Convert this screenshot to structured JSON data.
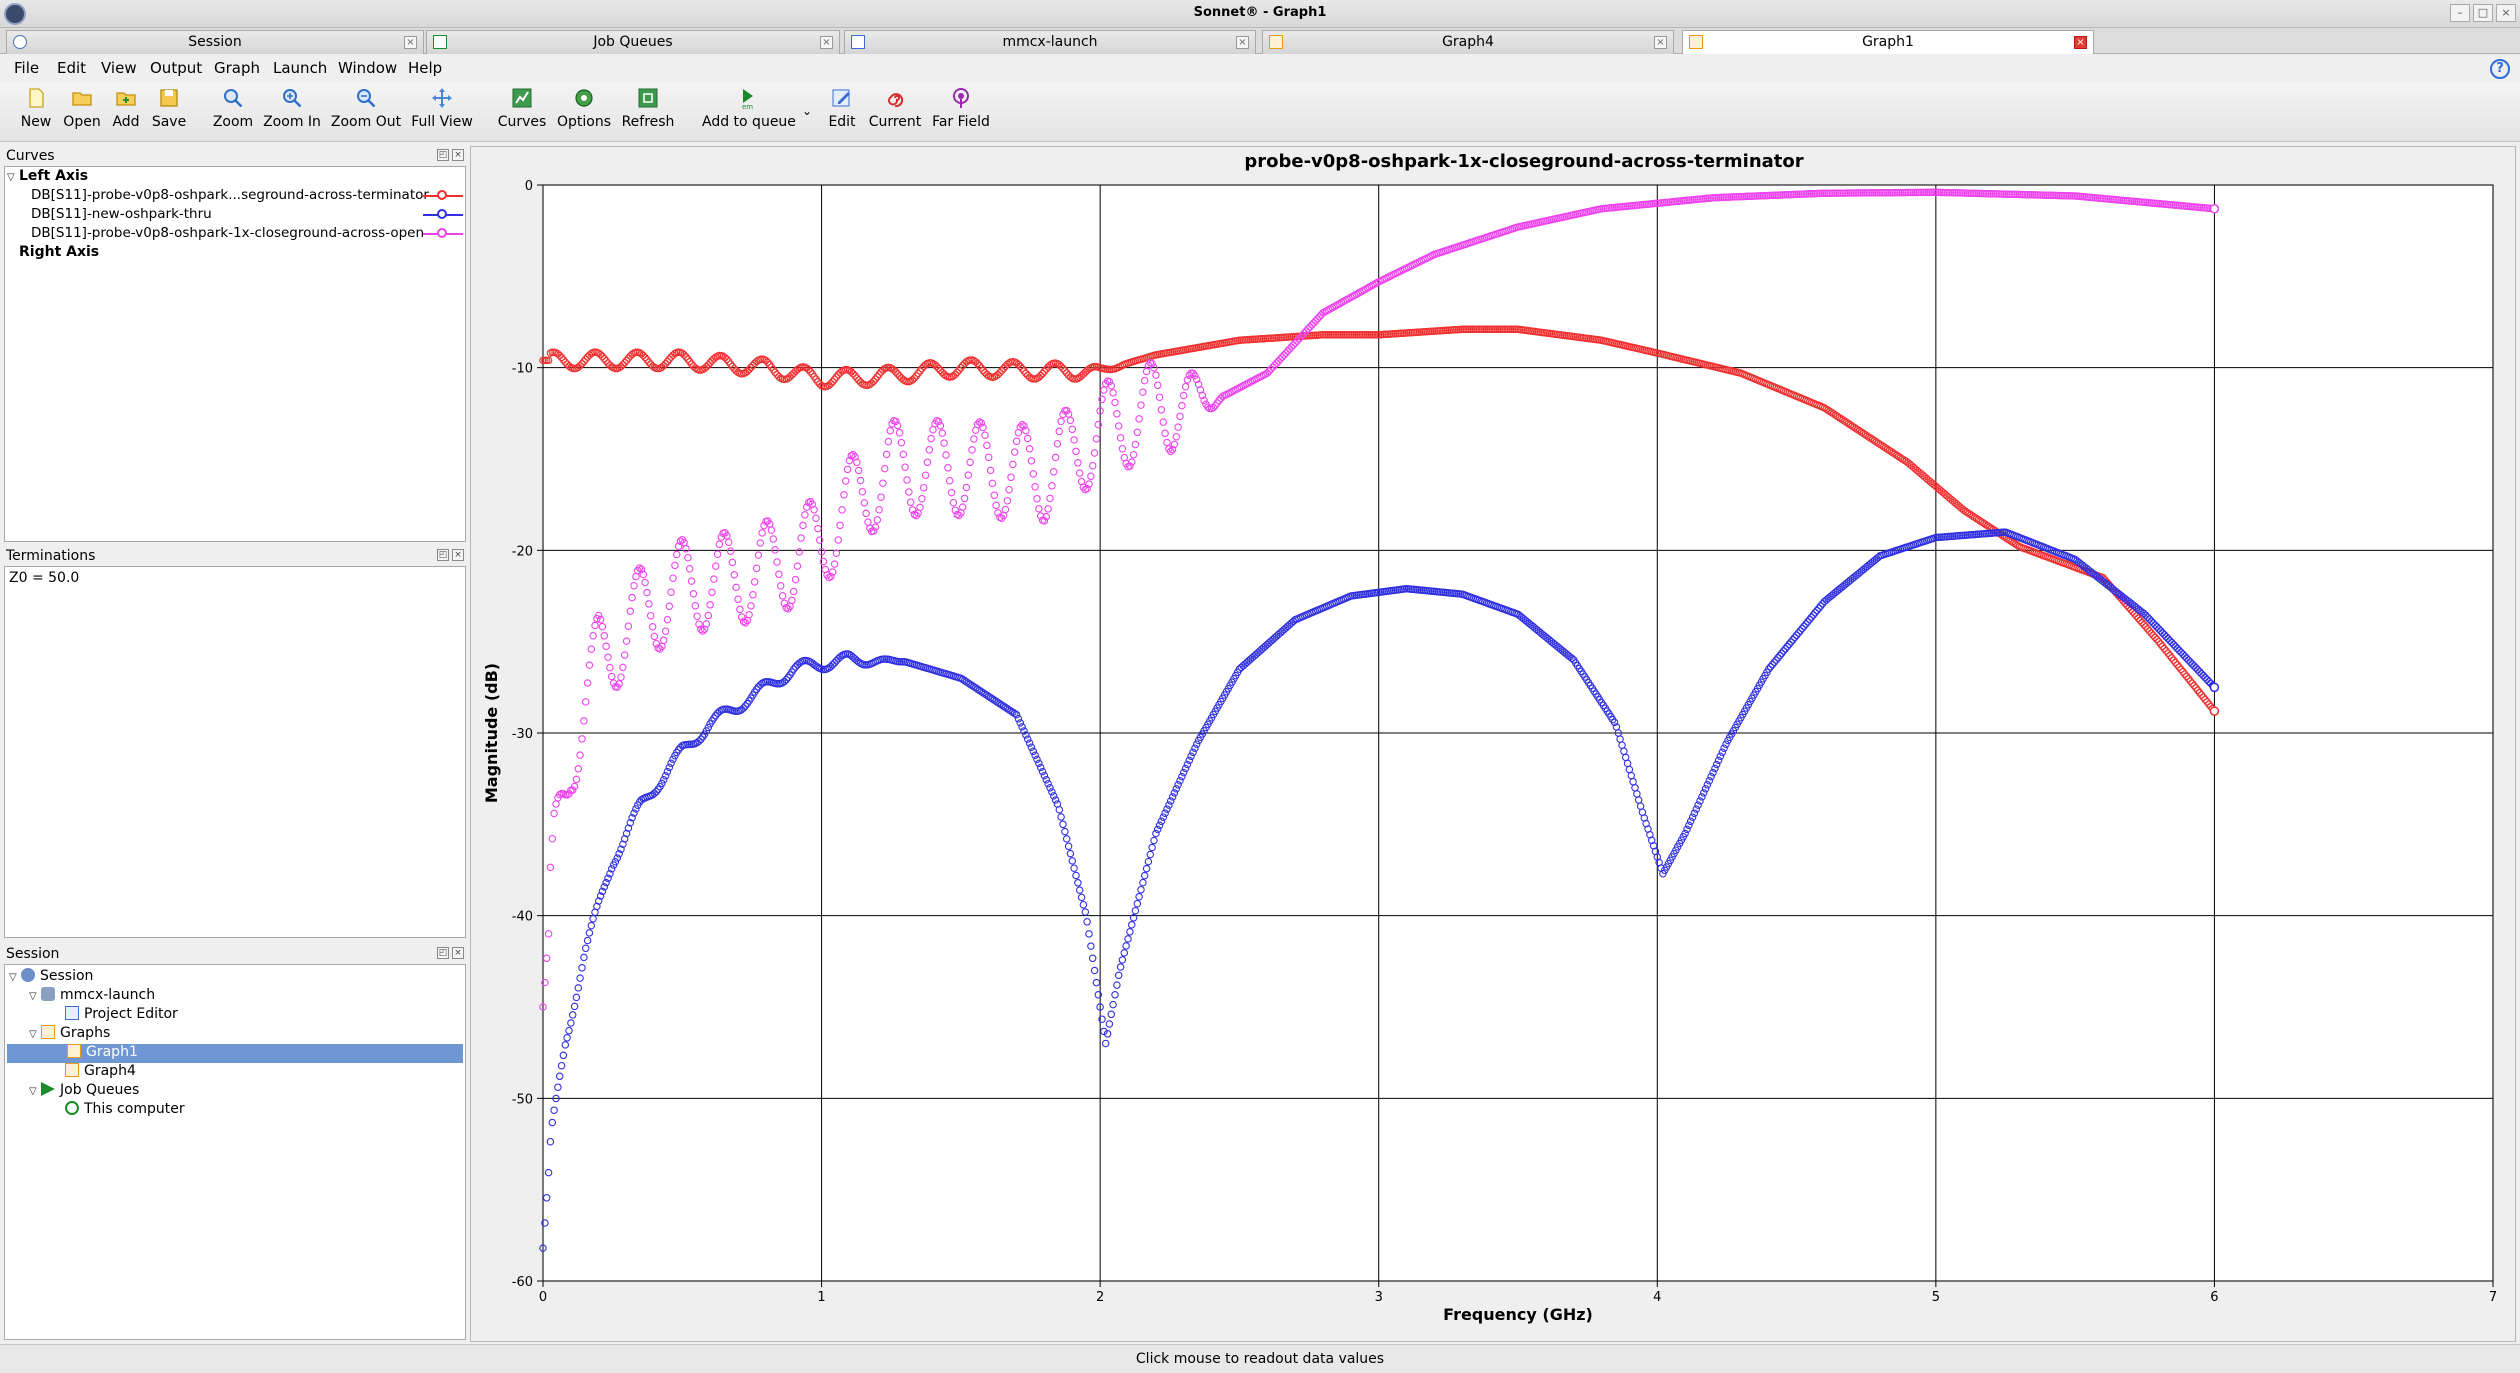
{
  "window": {
    "title": "Sonnet® - Graph1"
  },
  "tabs": [
    {
      "label": "Session",
      "active": false
    },
    {
      "label": "Job Queues",
      "active": false
    },
    {
      "label": "mmcx-launch",
      "active": false
    },
    {
      "label": "Graph4",
      "active": false
    },
    {
      "label": "Graph1",
      "active": true
    }
  ],
  "menu": [
    "File",
    "Edit",
    "View",
    "Output",
    "Graph",
    "Launch",
    "Window",
    "Help"
  ],
  "toolbar": {
    "new": "New",
    "open": "Open",
    "add": "Add",
    "save": "Save",
    "zoom": "Zoom",
    "zoom_in": "Zoom In",
    "zoom_out": "Zoom Out",
    "full_view": "Full View",
    "curves": "Curves",
    "options": "Options",
    "refresh": "Refresh",
    "add_to_queue": "Add to queue",
    "edit": "Edit",
    "current": "Current",
    "far_field": "Far Field"
  },
  "curves_panel": {
    "title": "Curves",
    "left_axis": "Left Axis",
    "right_axis": "Right Axis",
    "items": [
      {
        "label": "DB[S11]-probe-v0p8-oshpark...seground-across-terminator",
        "color": "#f03030"
      },
      {
        "label": "DB[S11]-new-oshpark-thru",
        "color": "#3030e0"
      },
      {
        "label": "DB[S11]-probe-v0p8-oshpark-1x-closeground-across-open",
        "color": "#ee44ee"
      }
    ]
  },
  "terminations_panel": {
    "title": "Terminations",
    "text": "Z0 = 50.0"
  },
  "session_panel": {
    "title": "Session",
    "tree": {
      "session": "Session",
      "project": "mmcx-launch",
      "project_editor": "Project Editor",
      "graphs": "Graphs",
      "graph1": "Graph1",
      "graph4": "Graph4",
      "job_queues": "Job Queues",
      "this_computer": "This computer"
    }
  },
  "status": {
    "text": "Click mouse to readout data values"
  },
  "chart_data": {
    "type": "scatter",
    "title": "probe-v0p8-oshpark-1x-closeground-across-terminator",
    "xlabel": "Frequency (GHz)",
    "ylabel": "Magnitude (dB)",
    "xlim": [
      0,
      7
    ],
    "ylim": [
      -60,
      0
    ],
    "xticks": [
      "0",
      "1",
      "2",
      "3",
      "4",
      "5",
      "6",
      "7"
    ],
    "yticks": [
      "0",
      "-10",
      "-20",
      "-30",
      "-40",
      "-50",
      "-60"
    ],
    "grid": true,
    "series": [
      {
        "name": "DB[S11]-probe-v0p8-oshpark...seground-across-terminator",
        "color": "#f03030",
        "ripple": {
          "amp": 0.45,
          "period": 0.15,
          "until": 2.1
        },
        "points": [
          [
            0,
            -9.6
          ],
          [
            0.5,
            -9.6
          ],
          [
            0.8,
            -10.0
          ],
          [
            1.0,
            -10.6
          ],
          [
            1.2,
            -10.5
          ],
          [
            1.5,
            -10.0
          ],
          [
            1.8,
            -10.2
          ],
          [
            2.0,
            -10.2
          ],
          [
            2.2,
            -9.3
          ],
          [
            2.5,
            -8.5
          ],
          [
            2.8,
            -8.2
          ],
          [
            3.0,
            -8.2
          ],
          [
            3.3,
            -7.9
          ],
          [
            3.5,
            -7.9
          ],
          [
            3.8,
            -8.5
          ],
          [
            4.0,
            -9.2
          ],
          [
            4.3,
            -10.3
          ],
          [
            4.6,
            -12.2
          ],
          [
            4.9,
            -15.2
          ],
          [
            5.1,
            -17.8
          ],
          [
            5.3,
            -19.8
          ],
          [
            5.6,
            -21.5
          ],
          [
            5.8,
            -25.0
          ],
          [
            6.0,
            -28.8
          ]
        ]
      },
      {
        "name": "DB[S11]-new-oshpark-thru",
        "color": "#3030e0",
        "ripple": {
          "amp": 0.35,
          "period": 0.15,
          "until": 1.3
        },
        "points": [
          [
            0,
            -58.2
          ],
          [
            0.03,
            -52
          ],
          [
            0.08,
            -47
          ],
          [
            0.15,
            -42
          ],
          [
            0.25,
            -37
          ],
          [
            0.35,
            -34
          ],
          [
            0.5,
            -31
          ],
          [
            0.6,
            -29.5
          ],
          [
            0.75,
            -28
          ],
          [
            0.9,
            -26.5
          ],
          [
            1.0,
            -26.2
          ],
          [
            1.1,
            -26.0
          ],
          [
            1.3,
            -26.1
          ],
          [
            1.5,
            -27.0
          ],
          [
            1.7,
            -29.0
          ],
          [
            1.85,
            -34.0
          ],
          [
            1.95,
            -40.0
          ],
          [
            2.02,
            -47.0
          ],
          [
            2.07,
            -43.0
          ],
          [
            2.2,
            -35.5
          ],
          [
            2.35,
            -30.5
          ],
          [
            2.5,
            -26.5
          ],
          [
            2.7,
            -23.8
          ],
          [
            2.9,
            -22.5
          ],
          [
            3.1,
            -22.1
          ],
          [
            3.3,
            -22.4
          ],
          [
            3.5,
            -23.5
          ],
          [
            3.7,
            -26.0
          ],
          [
            3.85,
            -29.5
          ],
          [
            3.95,
            -34.5
          ],
          [
            4.02,
            -37.7
          ],
          [
            4.1,
            -35.5
          ],
          [
            4.25,
            -30.5
          ],
          [
            4.4,
            -26.5
          ],
          [
            4.6,
            -22.8
          ],
          [
            4.8,
            -20.3
          ],
          [
            5.0,
            -19.3
          ],
          [
            5.25,
            -19.0
          ],
          [
            5.5,
            -20.5
          ],
          [
            5.75,
            -23.5
          ],
          [
            6.0,
            -27.5
          ]
        ]
      },
      {
        "name": "DB[S11]-probe-v0p8-oshpark-1x-closeground-across-open",
        "color": "#ee44ee",
        "ripple": {
          "amp": 2.6,
          "period": 0.153,
          "until": 2.45
        },
        "points": [
          [
            0,
            -45
          ],
          [
            0.04,
            -37
          ],
          [
            0.1,
            -31
          ],
          [
            0.2,
            -26
          ],
          [
            0.35,
            -23.5
          ],
          [
            0.5,
            -22
          ],
          [
            0.7,
            -21.5
          ],
          [
            0.9,
            -20.5
          ],
          [
            1.0,
            -19.5
          ],
          [
            1.1,
            -17.5
          ],
          [
            1.25,
            -15.5
          ],
          [
            1.5,
            -15.5
          ],
          [
            1.8,
            -15.8
          ],
          [
            2.0,
            -13.5
          ],
          [
            2.2,
            -12.2
          ],
          [
            2.45,
            -11.5
          ],
          [
            2.6,
            -10.3
          ],
          [
            2.8,
            -7.0
          ],
          [
            3.0,
            -5.3
          ],
          [
            3.2,
            -3.8
          ],
          [
            3.5,
            -2.3
          ],
          [
            3.8,
            -1.3
          ],
          [
            4.2,
            -0.7
          ],
          [
            4.6,
            -0.45
          ],
          [
            5.0,
            -0.4
          ],
          [
            5.5,
            -0.6
          ],
          [
            6.0,
            -1.3
          ]
        ]
      }
    ]
  }
}
